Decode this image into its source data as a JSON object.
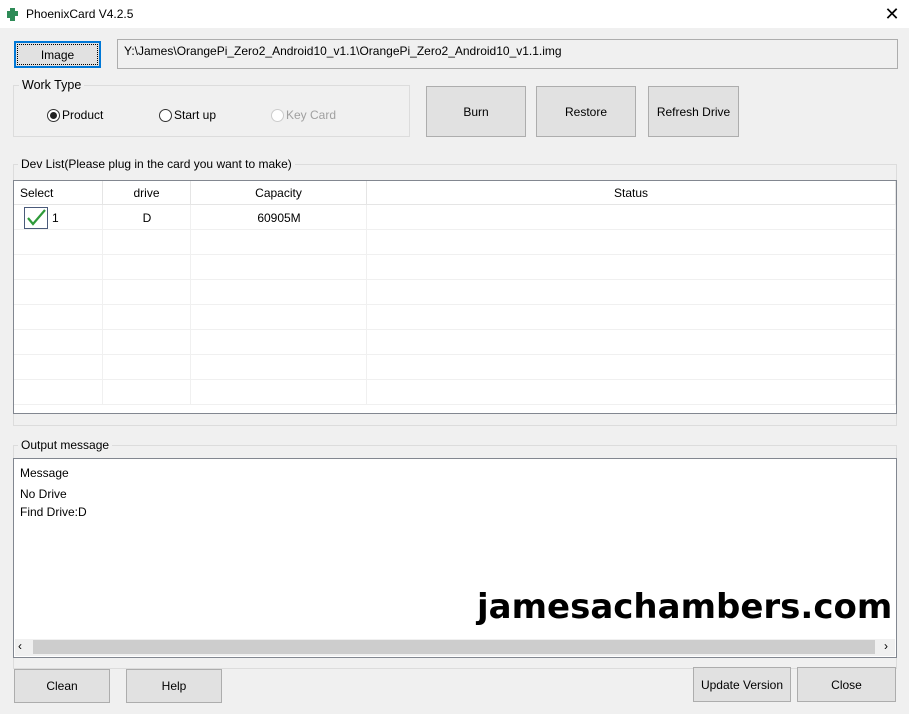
{
  "window": {
    "title": "PhoenixCard V4.2.5",
    "close_glyph": "✕"
  },
  "image_button": "Image",
  "image_path": "Y:\\James\\OrangePi_Zero2_Android10_v1.1\\OrangePi_Zero2_Android10_v1.1.img",
  "work_type": {
    "label": "Work Type",
    "options": [
      {
        "label": "Product",
        "selected": true,
        "enabled": true
      },
      {
        "label": "Start up",
        "selected": false,
        "enabled": true
      },
      {
        "label": "Key Card",
        "selected": false,
        "enabled": false
      }
    ]
  },
  "actions": {
    "burn": "Burn",
    "restore": "Restore",
    "refresh": "Refresh Drive"
  },
  "dev_list": {
    "label": "Dev List(Please plug in the card you want to make)",
    "columns": [
      "Select",
      "drive",
      "Capacity",
      "Status"
    ],
    "rows": [
      {
        "select": "1",
        "checked": true,
        "drive": "D",
        "capacity": "60905M",
        "status": ""
      }
    ]
  },
  "output": {
    "label": "Output message",
    "lines": [
      "Message",
      "No Drive",
      "Find Drive:D"
    ]
  },
  "watermark": "jamesachambers.com",
  "bottom": {
    "clean": "Clean",
    "help": "Help",
    "update": "Update Version",
    "close": "Close"
  },
  "colors": {
    "check": "#2e9a3a",
    "focus": "#0078d7"
  }
}
